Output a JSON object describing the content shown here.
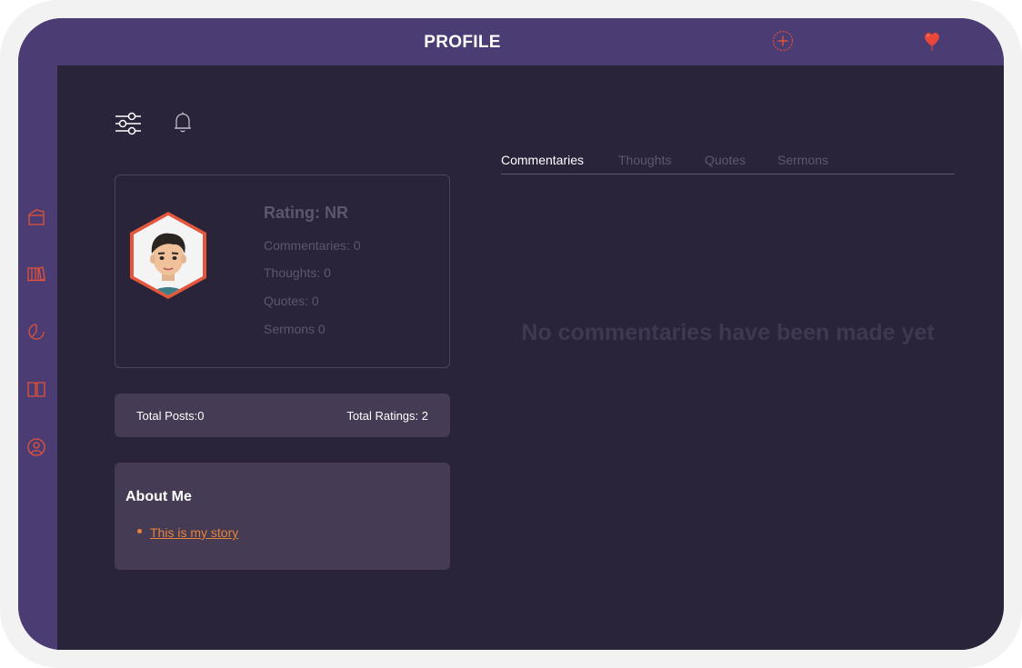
{
  "header": {
    "title": "PROFILE",
    "add_icon": "add-circle-icon",
    "favorite_icon": "heart-balloon-icon"
  },
  "sidebar": {
    "items": [
      {
        "icon": "home-icon"
      },
      {
        "icon": "library-icon"
      },
      {
        "icon": "pie-chart-icon"
      },
      {
        "icon": "book-icon"
      },
      {
        "icon": "profile-icon"
      }
    ]
  },
  "toolbar": {
    "filter_icon": "sliders-icon",
    "notification_icon": "bell-icon"
  },
  "profile": {
    "rating": "Rating: NR",
    "commentaries": "Commentaries: 0",
    "thoughts": "Thoughts: 0",
    "quotes": "Quotes: 0",
    "sermons": "Sermons 0"
  },
  "totals": {
    "posts": "Total Posts:0",
    "ratings": "Total Ratings: 2"
  },
  "about": {
    "title": "About Me",
    "link": "This is my story"
  },
  "tabs": [
    {
      "label": "Commentaries",
      "active": true
    },
    {
      "label": "Thoughts",
      "active": false
    },
    {
      "label": "Quotes",
      "active": false
    },
    {
      "label": "Sermons",
      "active": false
    }
  ],
  "content": {
    "empty_message": "No commentaries have been made yet"
  },
  "colors": {
    "accent": "#e8833a",
    "frame": "#4c3c74",
    "background": "#29243a",
    "card": "#453b54"
  }
}
